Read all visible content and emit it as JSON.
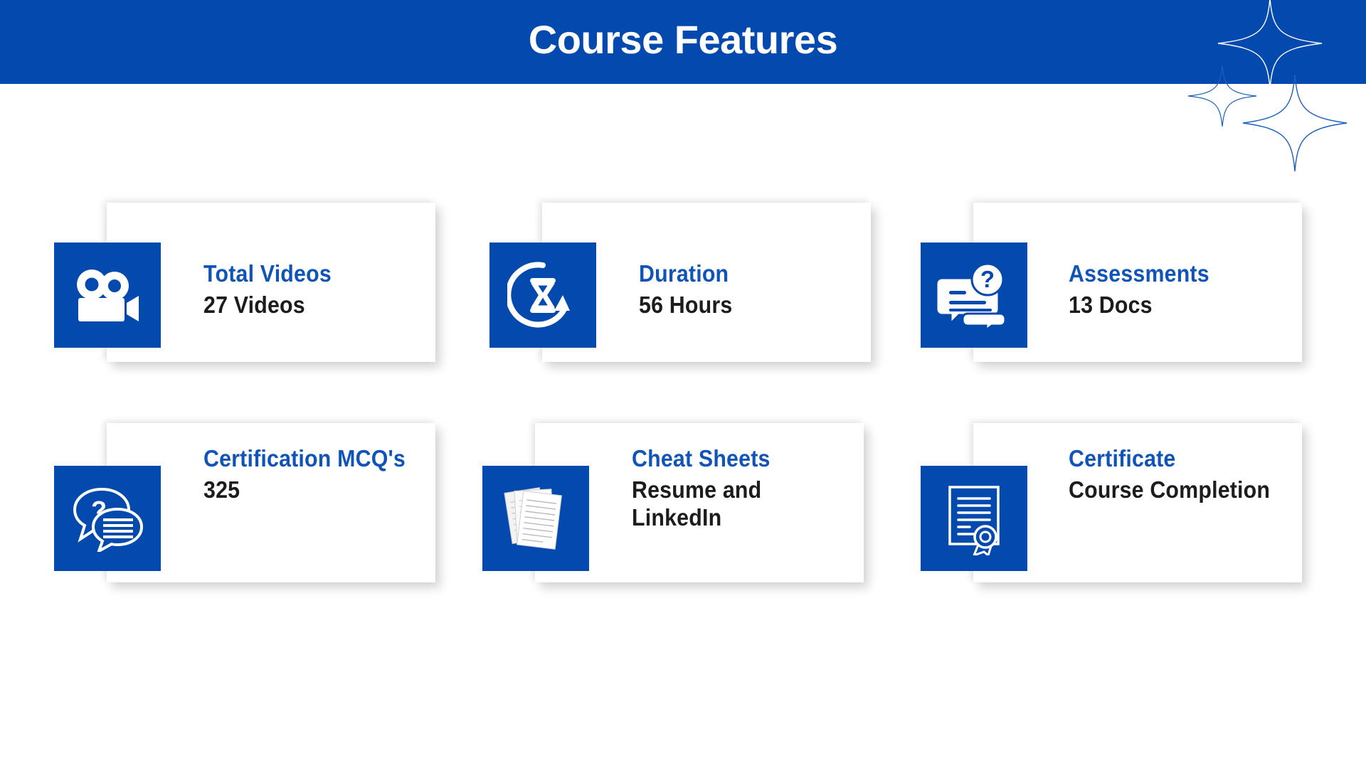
{
  "header": {
    "title": "Course Features",
    "band_color": "#0449ad",
    "title_color": "#ffffff",
    "decor": [
      "sparkle-icon",
      "sparkle-icon",
      "sparkle-icon"
    ]
  },
  "theme": {
    "brand_blue": "#0449ad",
    "title_blue": "#1154b8",
    "value_black": "#1c1c1c",
    "card_bg": "#ffffff",
    "page_bg": "#ffffff"
  },
  "cards": [
    {
      "icon": "video-camera-icon",
      "title": "Total Videos",
      "value": "27 Videos"
    },
    {
      "icon": "hourglass-rotate-icon",
      "title": "Duration",
      "value": "56 Hours"
    },
    {
      "icon": "question-chat-card-icon",
      "title": "Assessments",
      "value": "13 Docs"
    },
    {
      "icon": "question-speech-bubbles-icon",
      "title": "Certification MCQ's",
      "value": "325"
    },
    {
      "icon": "stacked-documents-icon",
      "title": "Cheat Sheets",
      "value": "Resume and LinkedIn"
    },
    {
      "icon": "certificate-ribbon-icon",
      "title": "Certificate",
      "value": "Course Completion"
    }
  ]
}
